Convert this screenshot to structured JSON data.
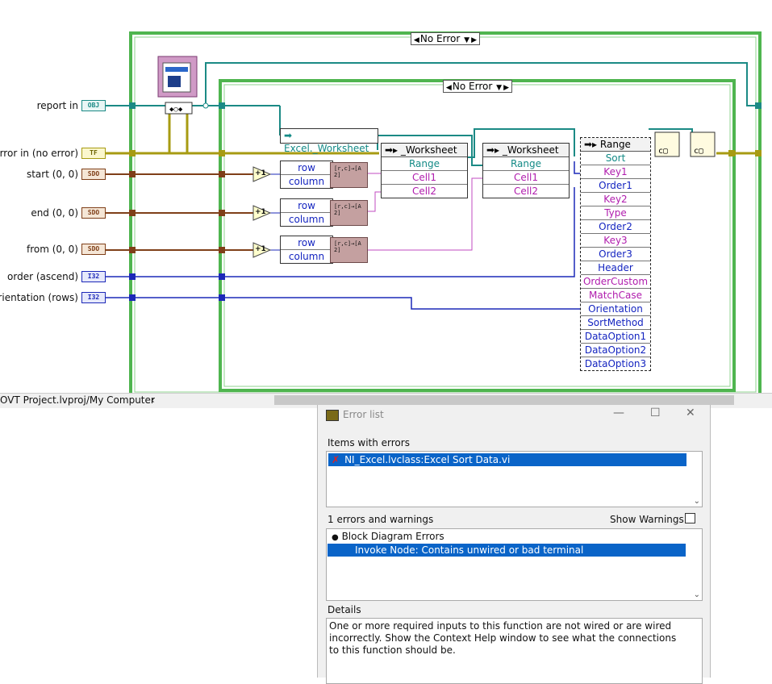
{
  "diagram": {
    "outer_case_label": "No Error",
    "inner_case_label": "No Error",
    "controls": [
      {
        "label": "report in",
        "terminal": "OBJ"
      },
      {
        "label": "error in (no error)",
        "terminal": "TF"
      },
      {
        "label": "start (0, 0)",
        "terminal": "SDO"
      },
      {
        "label": "end (0, 0)",
        "terminal": "SDO"
      },
      {
        "label": "from (0, 0)",
        "terminal": "SDO"
      },
      {
        "label": "order (ascend)",
        "terminal": "I32"
      },
      {
        "label": "orientation (rows)",
        "terminal": "I32"
      }
    ],
    "increment_label": "+1",
    "row_label": "row",
    "column_label": "column",
    "excel_worksheet_label": "Excel._Worksheet",
    "worksheet_node1": {
      "title": "_Worksheet",
      "rows": [
        "Range",
        "Cell1",
        "Cell2"
      ]
    },
    "worksheet_node2": {
      "title": "_Worksheet",
      "rows": [
        "Range",
        "Cell1",
        "Cell2"
      ]
    },
    "range_node": {
      "title": "Range",
      "rows": [
        "Sort",
        "Key1",
        "Order1",
        "Key2",
        "Type",
        "Order2",
        "Key3",
        "Order3",
        "Header",
        "OrderCustom",
        "MatchCase",
        "Orientation",
        "SortMethod",
        "DataOption1",
        "DataOption2",
        "DataOption3"
      ]
    },
    "status_path": "OVT Project.lvproj/My Computer"
  },
  "error_list": {
    "title": "Error list",
    "items_with_errors_label": "Items with errors",
    "items": [
      "NI_Excel.lvclass:Excel Sort Data.vi"
    ],
    "errors_count_label": "1 errors and warnings",
    "show_warnings_label": "Show Warnings",
    "error_tree": [
      {
        "text": "Block Diagram Errors",
        "level": 0
      },
      {
        "text": "Invoke Node: Contains unwired or bad terminal",
        "level": 1
      }
    ],
    "details_label": "Details",
    "details_text": "One or more required inputs to this function are not wired or are wired incorrectly. Show the Context Help window to see what the connections to this function should be."
  },
  "colors": {
    "case_border": "#4fb54f",
    "refnum_wire": "#1b8a85",
    "error_wire": "#a79b12",
    "cluster_wire": "#7f3f18",
    "int_wire": "#1c28b8",
    "selection": "#0a64c8"
  }
}
